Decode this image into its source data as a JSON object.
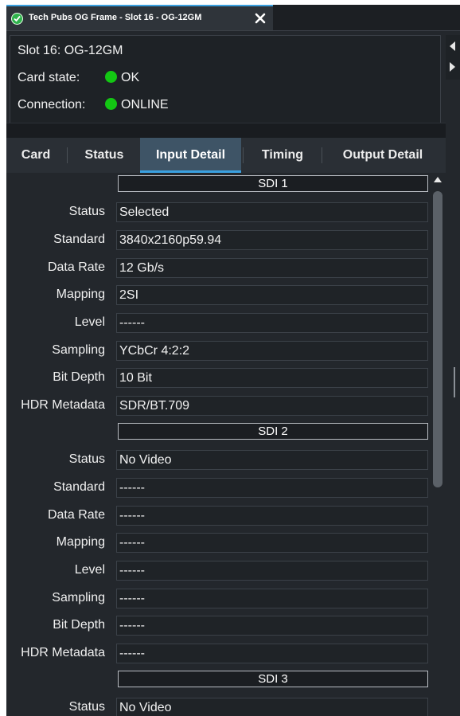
{
  "window": {
    "title": "Tech Pubs OG Frame - Slot 16 - OG-12GM",
    "close_glyph": "✕"
  },
  "header": {
    "slot": "Slot 16: OG-12GM",
    "card_state_label": "Card state:",
    "card_state_value": "OK",
    "connection_label": "Connection:",
    "connection_value": "ONLINE",
    "status_color": "#13c713"
  },
  "tabs": [
    {
      "label": "Card",
      "active": false
    },
    {
      "label": "Status",
      "active": false
    },
    {
      "label": "Input Detail",
      "active": true
    },
    {
      "label": "Timing",
      "active": false
    },
    {
      "label": "Output Detail",
      "active": false
    }
  ],
  "sections": [
    {
      "title": "SDI 1",
      "fields": [
        {
          "label": "Status",
          "value": "Selected"
        },
        {
          "label": "Standard",
          "value": "3840x2160p59.94"
        },
        {
          "label": "Data Rate",
          "value": "12 Gb/s"
        },
        {
          "label": "Mapping",
          "value": "2SI"
        },
        {
          "label": "Level",
          "value": "------"
        },
        {
          "label": "Sampling",
          "value": "YCbCr 4:2:2"
        },
        {
          "label": "Bit Depth",
          "value": "10 Bit"
        },
        {
          "label": "HDR Metadata",
          "value": "SDR/BT.709"
        }
      ]
    },
    {
      "title": "SDI 2",
      "fields": [
        {
          "label": "Status",
          "value": "No Video"
        },
        {
          "label": "Standard",
          "value": "------"
        },
        {
          "label": "Data Rate",
          "value": "------"
        },
        {
          "label": "Mapping",
          "value": "------"
        },
        {
          "label": "Level",
          "value": "------"
        },
        {
          "label": "Sampling",
          "value": "------"
        },
        {
          "label": "Bit Depth",
          "value": "------"
        },
        {
          "label": "HDR Metadata",
          "value": "------"
        }
      ]
    },
    {
      "title": "SDI 3",
      "fields": [
        {
          "label": "Status",
          "value": "No Video"
        }
      ]
    }
  ],
  "colors": {
    "accent": "#3aa0e0",
    "active_tab": "#3e5466",
    "background": "#23272c"
  }
}
